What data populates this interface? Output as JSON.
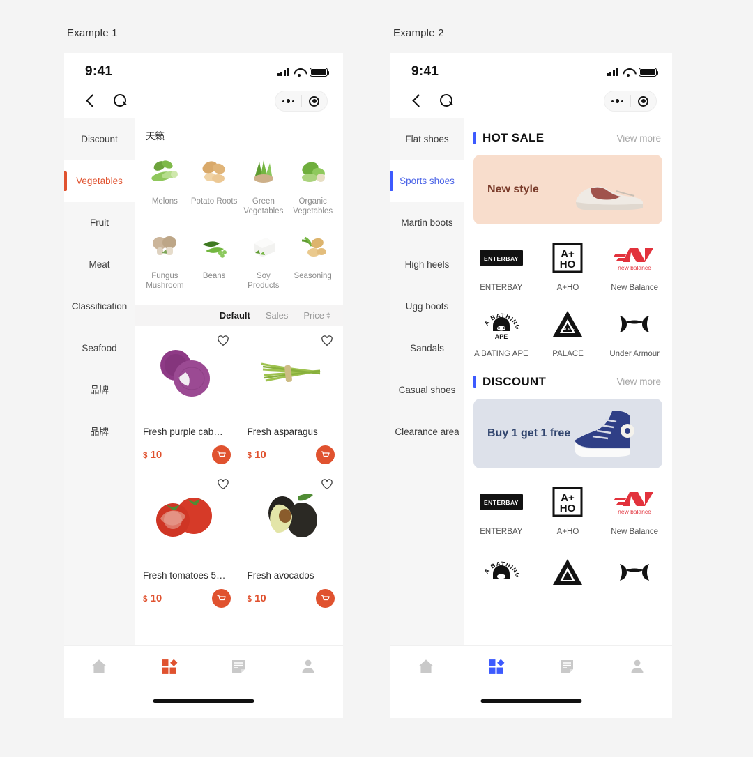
{
  "page": {
    "background": "#f4f4f4"
  },
  "examples": [
    {
      "label": "Example 1",
      "accent": "#e0522f",
      "status": {
        "time": "9:41"
      },
      "sidebar": [
        {
          "label": "Discount",
          "active": false
        },
        {
          "label": "Vegetables",
          "active": true
        },
        {
          "label": "Fruit",
          "active": false
        },
        {
          "label": "Meat",
          "active": false
        },
        {
          "label": "Classification",
          "active": false
        },
        {
          "label": "Seafood",
          "active": false
        },
        {
          "label": "品牌",
          "active": false
        },
        {
          "label": "品牌",
          "active": false
        }
      ],
      "category_header": "天籁",
      "categories": [
        {
          "label": "Melons",
          "icon": "melons-image"
        },
        {
          "label": "Potato Roots",
          "icon": "potato-roots-image"
        },
        {
          "label": "Green Vegetables",
          "icon": "green-vegetables-image"
        },
        {
          "label": "Organic Vegetables",
          "icon": "organic-vegetables-image"
        },
        {
          "label": "Fungus Mushroom",
          "icon": "fungus-mushroom-image"
        },
        {
          "label": "Beans",
          "icon": "beans-image"
        },
        {
          "label": "Soy Products",
          "icon": "soy-products-image"
        },
        {
          "label": "Seasoning",
          "icon": "seasoning-image"
        }
      ],
      "sort": [
        {
          "label": "Default",
          "active": true,
          "caret": false
        },
        {
          "label": "Sales",
          "active": false,
          "caret": false
        },
        {
          "label": "Price",
          "active": false,
          "caret": true
        }
      ],
      "products": [
        {
          "name": "Fresh purple cab…",
          "currency": "$",
          "price": "10",
          "icon": "purple-cabbage-image"
        },
        {
          "name": "Fresh asparagus",
          "currency": "$",
          "price": "10",
          "icon": "asparagus-image"
        },
        {
          "name": "Fresh tomatoes 5…",
          "currency": "$",
          "price": "10",
          "icon": "tomatoes-image"
        },
        {
          "name": "Fresh avocados",
          "currency": "$",
          "price": "10",
          "icon": "avocados-image"
        }
      ],
      "tabs": [
        {
          "icon": "home-icon",
          "active": false
        },
        {
          "icon": "category-grid-icon",
          "active": true
        },
        {
          "icon": "orders-document-icon",
          "active": false
        },
        {
          "icon": "profile-person-icon",
          "active": false
        }
      ]
    },
    {
      "label": "Example 2",
      "accent": "#3d5afe",
      "status": {
        "time": "9:41"
      },
      "sidebar": [
        {
          "label": "Flat shoes",
          "active": false
        },
        {
          "label": "Sports shoes",
          "active": true
        },
        {
          "label": "Martin boots",
          "active": false
        },
        {
          "label": "High heels",
          "active": false
        },
        {
          "label": "Ugg boots",
          "active": false
        },
        {
          "label": "Sandals",
          "active": false
        },
        {
          "label": "Casual shoes",
          "active": false
        },
        {
          "label": "Clearance area",
          "active": false
        }
      ],
      "sections": [
        {
          "title": "HOT SALE",
          "view_more": "View more",
          "banner": {
            "text": "New style",
            "bg": "#f8ddcc",
            "text_color": "#7a3b2a",
            "icon": "sneaker-image"
          },
          "brands": [
            {
              "label": "ENTERBAY",
              "logo": "enterbay-logo"
            },
            {
              "label": "A+HO",
              "logo": "a-plus-ho-logo"
            },
            {
              "label": "New Balance",
              "logo": "new-balance-logo"
            },
            {
              "label": "A BATING APE",
              "logo": "a-bathing-ape-logo"
            },
            {
              "label": "PALACE",
              "logo": "palace-logo"
            },
            {
              "label": "Under Armour",
              "logo": "under-armour-logo"
            }
          ]
        },
        {
          "title": "DISCOUNT",
          "view_more": "View more",
          "banner": {
            "text": "Buy 1 get 1 free",
            "bg": "#dde1ea",
            "text_color": "#31456e",
            "icon": "high-top-sneaker-image"
          },
          "brands": [
            {
              "label": "ENTERBAY",
              "logo": "enterbay-logo"
            },
            {
              "label": "A+HO",
              "logo": "a-plus-ho-logo"
            },
            {
              "label": "New Balance",
              "logo": "new-balance-logo"
            }
          ]
        }
      ],
      "tabs": [
        {
          "icon": "home-icon",
          "active": false
        },
        {
          "icon": "category-grid-icon",
          "active": true
        },
        {
          "icon": "orders-document-icon",
          "active": false
        },
        {
          "icon": "profile-person-icon",
          "active": false
        }
      ]
    }
  ]
}
